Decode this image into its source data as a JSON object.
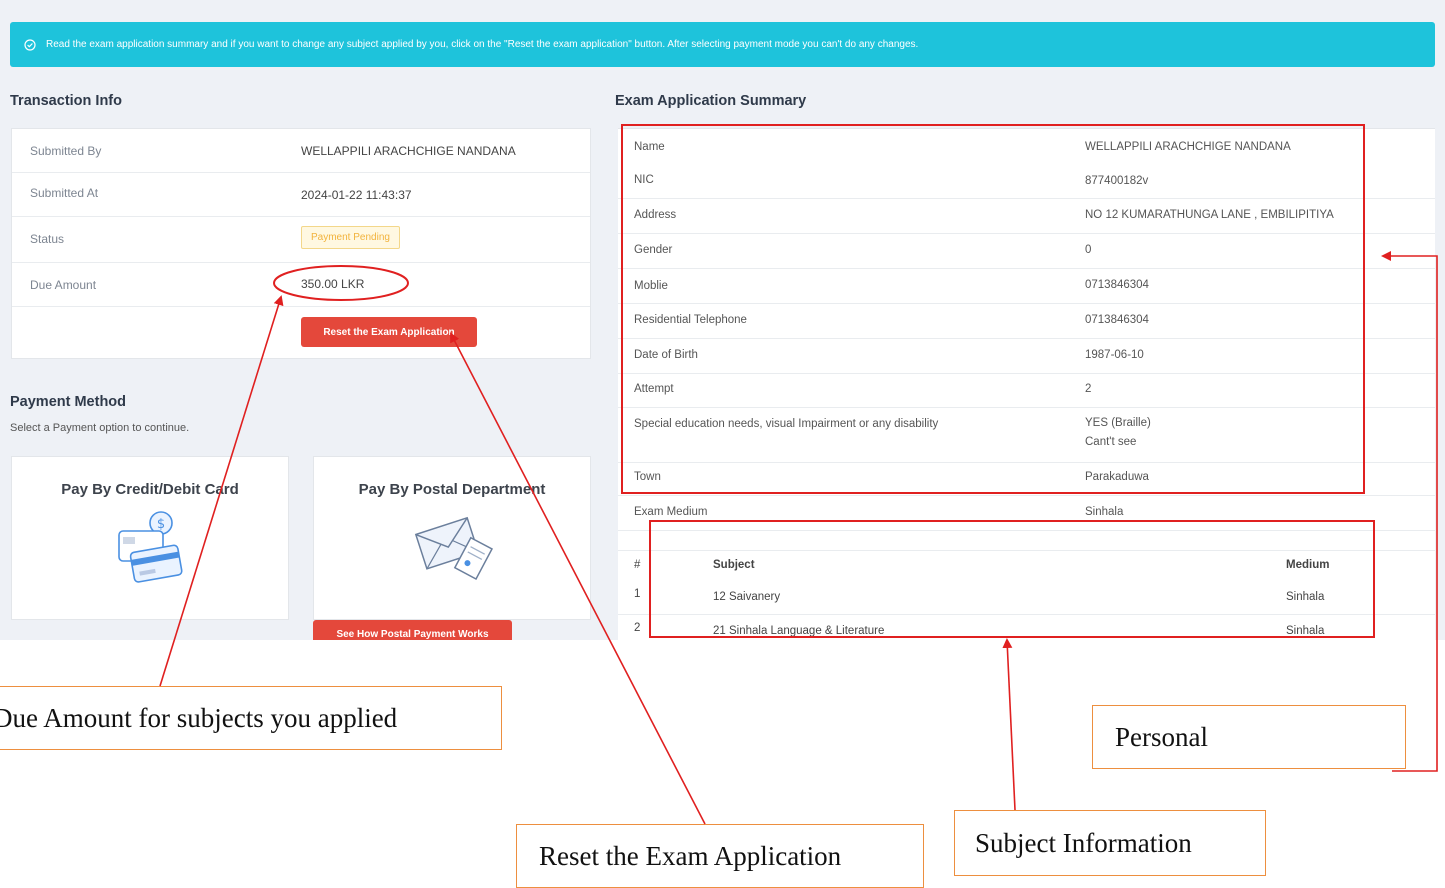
{
  "alert": {
    "text": "Read the exam application summary and if you want to change any subject applied by you, click on the \"Reset the exam application\" button. After selecting payment mode you can't do any changes."
  },
  "transaction": {
    "title": "Transaction Info",
    "submitted_by_label": "Submitted By",
    "submitted_by_value": "WELLAPPILI ARACHCHIGE NANDANA",
    "submitted_at_label": "Submitted At",
    "submitted_at_value": "2024-01-22 11:43:37",
    "status_label": "Status",
    "status_value": "Payment Pending",
    "due_label": "Due Amount",
    "due_value": "350.00 LKR",
    "reset_button": "Reset the Exam Application"
  },
  "payment": {
    "title": "Payment Method",
    "subtitle": "Select a Payment option to continue.",
    "card_option": "Pay By Credit/Debit Card",
    "postal_option": "Pay By Postal Department",
    "postal_button": "See How Postal Payment Works"
  },
  "summary": {
    "title": "Exam Application Summary",
    "rows": [
      {
        "label": "Name",
        "value": "WELLAPPILI ARACHCHIGE NANDANA"
      },
      {
        "label": "NIC",
        "value": "877400182v"
      },
      {
        "label": "Address",
        "value": "NO 12 KUMARATHUNGA LANE , EMBILIPITIYA"
      },
      {
        "label": "Gender",
        "value": "0"
      },
      {
        "label": "Moblie",
        "value": "0713846304"
      },
      {
        "label": "Residential Telephone",
        "value": "0713846304"
      },
      {
        "label": "Date of Birth",
        "value": "1987-06-10"
      },
      {
        "label": "Attempt",
        "value": "2"
      },
      {
        "label": "Special education needs, visual Impairment or any disability",
        "value": "YES (Braille)",
        "value2": "Cant't see"
      },
      {
        "label": "Town",
        "value": "Parakaduwa"
      },
      {
        "label": "Exam Medium",
        "value": "Sinhala"
      }
    ],
    "subject_headers": {
      "num": "#",
      "subject": "Subject",
      "medium": "Medium"
    },
    "subjects": [
      {
        "num": "1",
        "subject": "12 Saivanery",
        "medium": "Sinhala"
      },
      {
        "num": "2",
        "subject": "21 Sinhala Language & Literature",
        "medium": "Sinhala"
      }
    ]
  },
  "annotations": {
    "due_amount": "Due Amount for subjects you applied",
    "reset": "Reset the Exam Application",
    "subject_info": "Subject Information",
    "personal": "Personal"
  },
  "colors": {
    "alert_bg": "#1ec3db",
    "button_red": "#e4483b",
    "highlight_red": "#e02020",
    "annotation_border": "#ed8f3f",
    "badge_text": "#f2b33d"
  }
}
